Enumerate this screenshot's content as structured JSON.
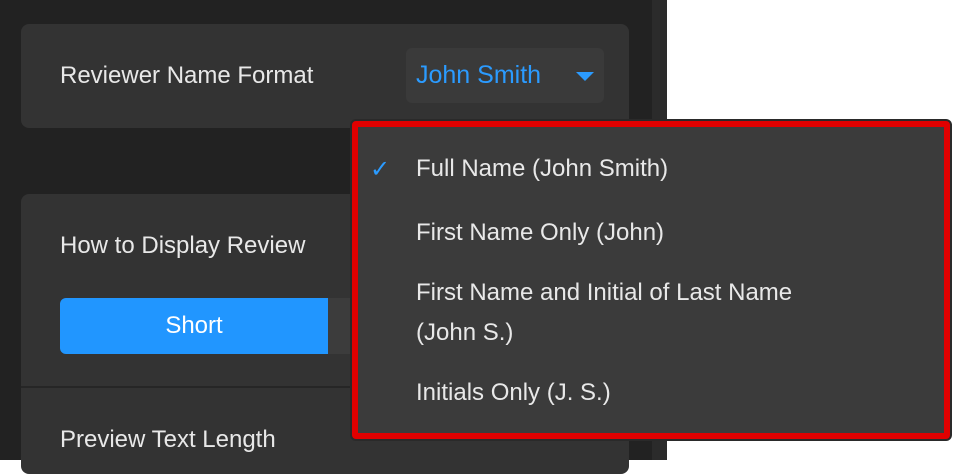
{
  "reviewer_name_format": {
    "label": "Reviewer Name Format",
    "selected": "John Smith"
  },
  "display_reviews": {
    "label": "How to Display Review",
    "options": [
      "Short"
    ],
    "active": "Short"
  },
  "preview_text_length": {
    "label": "Preview Text Length"
  },
  "dropdown": {
    "options": [
      {
        "label": "Full Name (John Smith)",
        "checked": true
      },
      {
        "label": "First Name Only (John)",
        "checked": false
      },
      {
        "label": "First Name and Initial of Last Name",
        "label2": "(John S.)",
        "checked": false
      },
      {
        "label": "Initials Only (J. S.)",
        "checked": false
      }
    ]
  },
  "colors": {
    "accent": "#2196ff",
    "highlight": "#e00000"
  }
}
